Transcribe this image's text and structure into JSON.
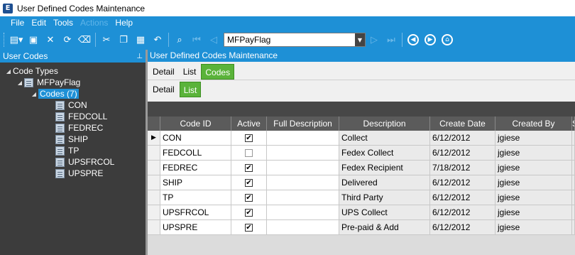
{
  "window": {
    "title": "User Defined Codes Maintenance",
    "app_icon": "E"
  },
  "menu": {
    "items": [
      {
        "label": "File",
        "enabled": true
      },
      {
        "label": "Edit",
        "enabled": true
      },
      {
        "label": "Tools",
        "enabled": true
      },
      {
        "label": "Actions",
        "enabled": false
      },
      {
        "label": "Help",
        "enabled": true
      }
    ]
  },
  "toolbar": {
    "icons": [
      "new-icon",
      "save-icon",
      "delete-icon",
      "refresh-icon",
      "clear-icon",
      "cut-icon",
      "copy-icon",
      "paste-icon",
      "undo-icon",
      "search-icon",
      "first-record-icon",
      "previous-record-icon"
    ],
    "combo_value": "MFPayFlag",
    "nav_icons": [
      "next-record-icon",
      "last-record-icon",
      "back-icon",
      "forward-icon",
      "home-icon"
    ]
  },
  "left_panel": {
    "header": "User Codes",
    "tree": {
      "root": "Code Types",
      "type": "MFPayFlag",
      "codes_label": "Codes (7)",
      "codes": [
        "CON",
        "FEDCOLL",
        "FEDREC",
        "SHIP",
        "TP",
        "UPSFRCOL",
        "UPSPRE"
      ]
    }
  },
  "main": {
    "header": "User Defined Codes Maintenance",
    "tabs": [
      "Detail",
      "List",
      "Codes"
    ],
    "active_tab": "Codes",
    "subtabs": [
      "Detail",
      "List"
    ],
    "active_subtab": "List",
    "grid": {
      "columns": [
        "Code ID",
        "Active",
        "Full Description",
        "Description",
        "Create Date",
        "Created By",
        "S"
      ],
      "rows": [
        {
          "code": "CON",
          "active": true,
          "full": "",
          "desc": "Collect",
          "date": "6/12/2012",
          "by": "jgiese",
          "current": true
        },
        {
          "code": "FEDCOLL",
          "active": false,
          "full": "",
          "desc": "Fedex Collect",
          "date": "6/12/2012",
          "by": "jgiese",
          "current": false
        },
        {
          "code": "FEDREC",
          "active": true,
          "full": "",
          "desc": "Fedex Recipient",
          "date": "7/18/2012",
          "by": "jgiese",
          "current": false
        },
        {
          "code": "SHIP",
          "active": true,
          "full": "",
          "desc": "Delivered",
          "date": "6/12/2012",
          "by": "jgiese",
          "current": false
        },
        {
          "code": "TP",
          "active": true,
          "full": "",
          "desc": "Third Party",
          "date": "6/12/2012",
          "by": "jgiese",
          "current": false
        },
        {
          "code": "UPSFRCOL",
          "active": true,
          "full": "",
          "desc": "UPS Collect",
          "date": "6/12/2012",
          "by": "jgiese",
          "current": false
        },
        {
          "code": "UPSPRE",
          "active": true,
          "full": "",
          "desc": "Pre-paid & Add",
          "date": "6/12/2012",
          "by": "jgiese",
          "current": false
        }
      ]
    }
  },
  "colors": {
    "accent": "#1e90d6",
    "tab_active": "#5ab33a",
    "panel_dark": "#3c3c3c"
  }
}
